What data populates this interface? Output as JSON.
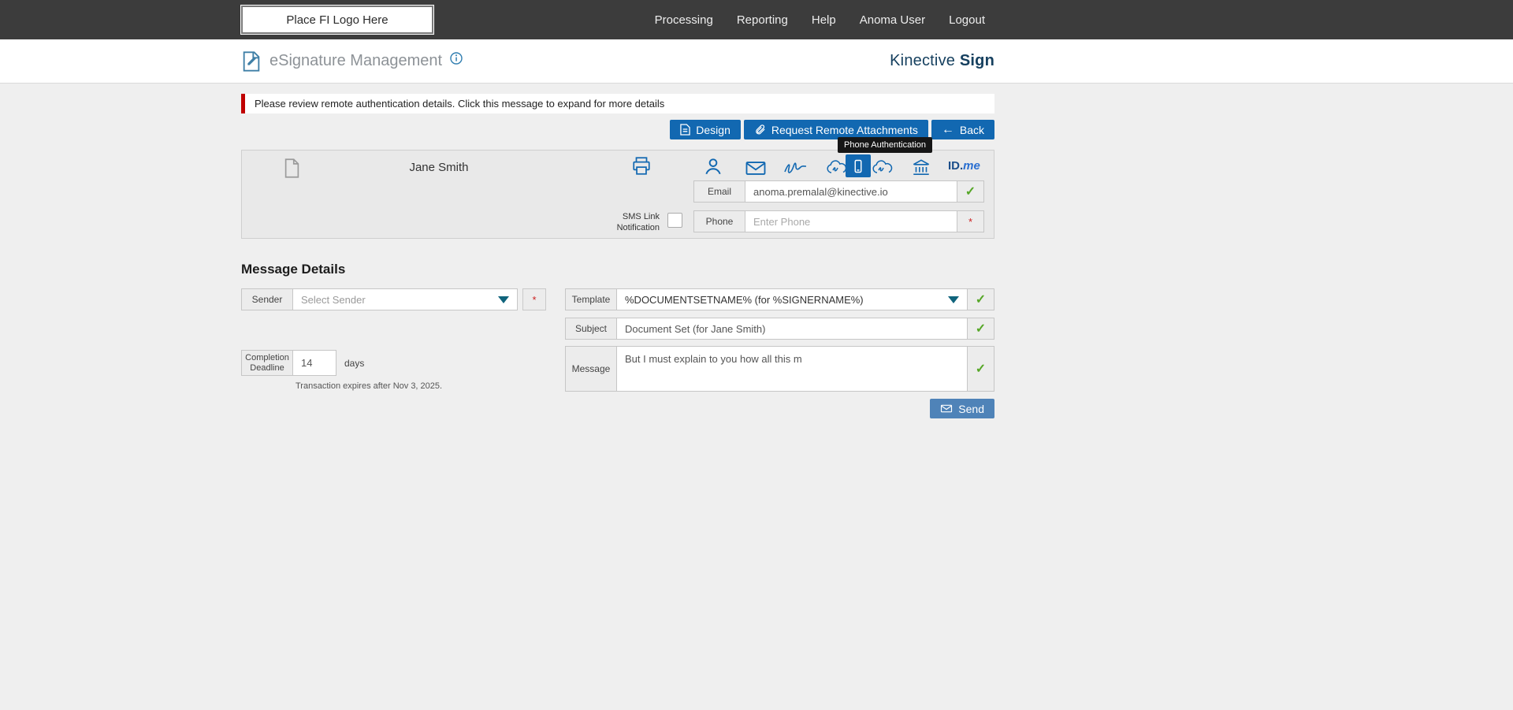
{
  "topbar": {
    "logo_label": "Place FI Logo Here",
    "nav": [
      "Processing",
      "Reporting",
      "Help",
      "Anoma User",
      "Logout"
    ]
  },
  "header": {
    "title": "eSignature Management",
    "brand_regular": "Kinective ",
    "brand_bold": "Sign"
  },
  "alert": {
    "text": "Please review remote authentication details. Click this message to expand for more details"
  },
  "actions": {
    "design": "Design",
    "request_remote_attachments": "Request Remote Attachments",
    "back": "Back"
  },
  "tooltip": {
    "text": "Phone Authentication"
  },
  "signer": {
    "name": "Jane Smith",
    "email_label": "Email",
    "email_value": "anoma.premalal@kinective.io",
    "sms_link_line1": "SMS Link",
    "sms_link_line2": "Notification",
    "phone_label": "Phone",
    "phone_placeholder": "Enter Phone",
    "idme_bold": "ID.",
    "idme_italic": "me"
  },
  "message_details": {
    "heading": "Message Details",
    "sender_label": "Sender",
    "sender_placeholder": "Select Sender",
    "completion_line1": "Completion",
    "completion_line2": "Deadline",
    "completion_value": "14",
    "days_label": "days",
    "expiry_note": "Transaction expires after Nov 3, 2025.",
    "template_label": "Template",
    "template_value": "%DOCUMENTSETNAME% (for %SIGNERNAME%)",
    "subject_label": "Subject",
    "subject_value": "Document Set (for Jane Smith)",
    "message_label": "Message",
    "message_value": "But I must explain to you how all this m",
    "send_label": "Send"
  },
  "icons": {
    "back_arrow": "←",
    "check": "✓",
    "required_asterisk": "*"
  },
  "colors": {
    "topbar_gray": "#3c3c3c",
    "accent_blue": "#1268b1",
    "brand_navy": "#16405f",
    "success_green": "#56a728",
    "alert_red": "#c00000",
    "send_blue": "#4f83b8"
  }
}
